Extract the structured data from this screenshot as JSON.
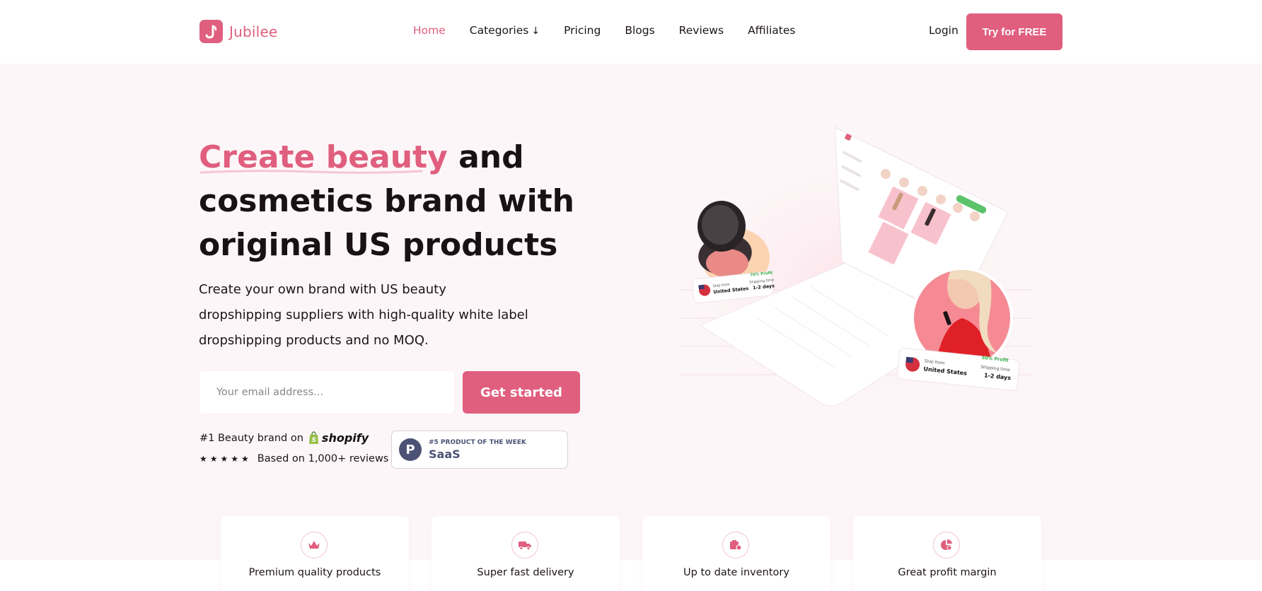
{
  "brand": {
    "name": "Jubilee",
    "logo_letter": "J",
    "accent": "#e05e7e"
  },
  "nav": {
    "items": [
      {
        "label": "Home",
        "active": true
      },
      {
        "label": "Categories",
        "arrow": "↓"
      },
      {
        "label": "Pricing"
      },
      {
        "label": "Blogs"
      },
      {
        "label": "Reviews"
      },
      {
        "label": "Affiliates"
      }
    ],
    "login": "Login",
    "cta": "Try for FREE"
  },
  "hero": {
    "title_highlight": "Create beauty",
    "title_rest_1": " and",
    "title_line_2": "cosmetics brand with",
    "title_line_3": "original US products",
    "subtitle": "Create your own brand with US beauty dropshipping suppliers with high-quality white label dropshipping products and no MOQ.",
    "email_placeholder": "Your email address...",
    "cta": "Get started",
    "rank_text": "#1 Beauty brand on",
    "shopify": "shopify",
    "stars": "★★★★★",
    "reviews_text": "Based on 1,000+ reviews",
    "ph_badge": {
      "letter": "P",
      "top": "#5 PRODUCT OF THE WEEK",
      "bottom": "SaaS"
    }
  },
  "illustration": {
    "card_left": {
      "ship_label": "Ship from",
      "ship_value": "United States",
      "time_label": "Shipping time",
      "time_value": "1-2 days",
      "profit": "70% Profit"
    },
    "card_right": {
      "ship_label": "Ship from",
      "ship_value": "United States",
      "time_label": "Shipping time",
      "time_value": "1-2 days",
      "profit": "50% Profit"
    }
  },
  "features": [
    {
      "icon": "crown-icon",
      "label": "Premium quality products"
    },
    {
      "icon": "truck-icon",
      "label": "Super fast delivery"
    },
    {
      "icon": "box-icon",
      "label": "Up to date inventory"
    },
    {
      "icon": "pie-chart-icon",
      "label": "Great profit margin"
    }
  ]
}
